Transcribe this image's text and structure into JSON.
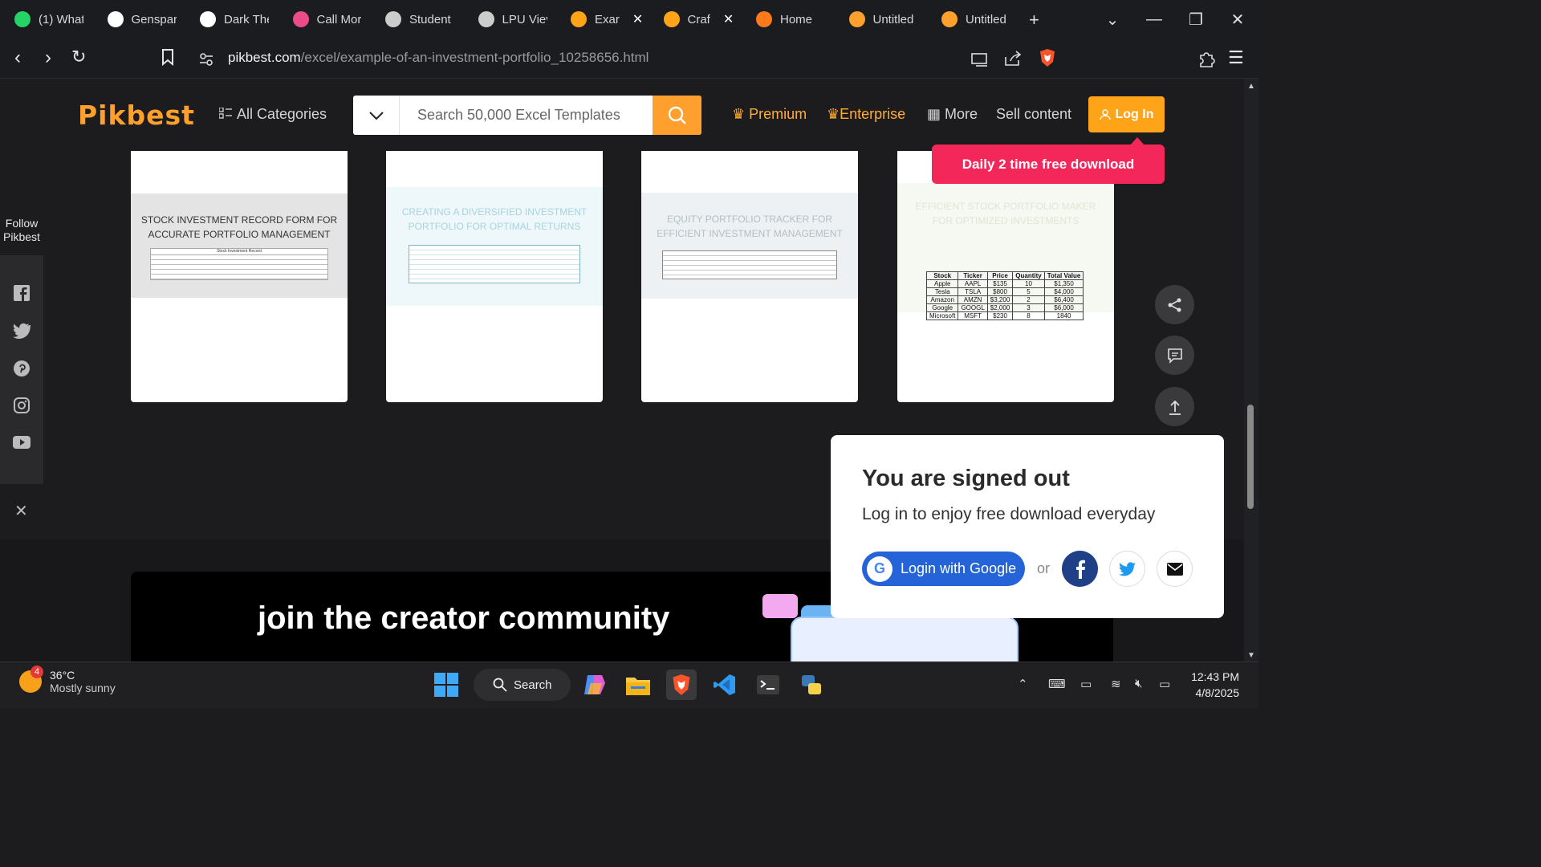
{
  "browser": {
    "tabs": [
      {
        "title": "(1) What",
        "icon": "whatsapp-icon",
        "color": "#25d366"
      },
      {
        "title": "Genspar",
        "icon": "genspark-icon",
        "color": "#ffffff"
      },
      {
        "title": "Dark The",
        "icon": "openai-icon",
        "color": "#ffffff"
      },
      {
        "title": "Call Mor",
        "icon": "dribbble-icon",
        "color": "#ea4c89"
      },
      {
        "title": "Student",
        "icon": "globe-icon",
        "color": "#cccccc"
      },
      {
        "title": "LPU Viev",
        "icon": "globe-icon",
        "color": "#cccccc"
      },
      {
        "title": "Exar",
        "icon": "pikbest-tab-icon",
        "color": "#ffa319",
        "close": "✕"
      },
      {
        "title": "Craf",
        "icon": "pikbest-tab-icon",
        "color": "#ffa319",
        "close": "✕"
      },
      {
        "title": "Home",
        "icon": "loading-icon",
        "color": "#ff7a1a"
      },
      {
        "title": "Untitled",
        "icon": "notebook-icon",
        "color": "#ff9f2d"
      },
      {
        "title": "Untitled",
        "icon": "notebook-icon",
        "color": "#ff9f2d"
      }
    ],
    "new_tab": "+",
    "url_host": "pikbest.com",
    "url_path": "/excel/example-of-an-investment-portfolio_10258656.html"
  },
  "site": {
    "logo": "Pikbest",
    "all_categories": "All Categories",
    "search_placeholder": "Search 50,000 Excel Templates",
    "premium": "Premium",
    "enterprise": "Enterprise",
    "more": "More",
    "sell": "Sell content",
    "login": "Log In",
    "promo": "Daily 2 time free download",
    "brand_color": "#ffa319",
    "promo_color": "#f4275b"
  },
  "follow": {
    "label_1": "Follow",
    "label_2": "Pikbest",
    "icons": [
      "facebook-icon",
      "twitter-icon",
      "pinterest-icon",
      "instagram-icon",
      "youtube-icon"
    ]
  },
  "cards": [
    {
      "title": "STOCK INVESTMENT RECORD FORM FOR ACCURATE PORTFOLIO MANAGEMENT",
      "table_caption": "Stock Investment Record"
    },
    {
      "title": "CREATING A DIVERSIFIED INVESTMENT PORTFOLIO FOR OPTIMAL RETURNS"
    },
    {
      "title": "EQUITY PORTFOLIO TRACKER FOR EFFICIENT INVESTMENT MANAGEMENT"
    },
    {
      "title": "EFFICIENT STOCK PORTFOLIO MAKER FOR OPTIMIZED INVESTMENTS",
      "table": {
        "headers": [
          "Stock",
          "Ticker",
          "Price",
          "Quantity",
          "Total Value"
        ],
        "rows": [
          [
            "Apple",
            "AAPL",
            "$135",
            "10",
            "$1,350"
          ],
          [
            "Tesla",
            "TSLA",
            "$800",
            "5",
            "$4,000"
          ],
          [
            "Amazon",
            "AMZN",
            "$3,200",
            "2",
            "$6,400"
          ],
          [
            "Google",
            "GOOGL",
            "$2,000",
            "3",
            "$6,000"
          ],
          [
            "Microsoft",
            "MSFT",
            "$230",
            "8",
            "1840"
          ]
        ]
      }
    }
  ],
  "banner": {
    "title": "join the creator community"
  },
  "popup": {
    "title": "You are signed out",
    "subtitle": "Log in to enjoy free download everyday",
    "google": "Login with Google",
    "or": "or"
  },
  "taskbar": {
    "weather_badge": "4",
    "temp": "36°C",
    "condition": "Mostly sunny",
    "search": "Search",
    "time": "12:43 PM",
    "date": "4/8/2025"
  }
}
